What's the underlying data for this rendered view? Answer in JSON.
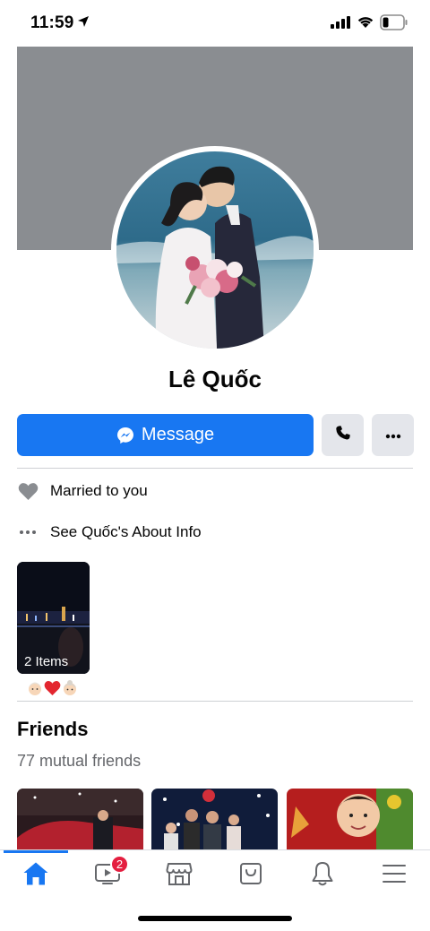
{
  "status_bar": {
    "time": "11:59"
  },
  "profile": {
    "name": "Lê Quốc",
    "message_label": "Message"
  },
  "info": {
    "relationship": "Married to you",
    "about": "See Quốc's About Info"
  },
  "highlight": {
    "label": "2 Items"
  },
  "friends": {
    "title": "Friends",
    "count": "77 mutual friends"
  },
  "tab_bar": {
    "items": [
      "home",
      "watch",
      "marketplace",
      "shop",
      "notifications",
      "menu"
    ],
    "watch_badge": "2"
  },
  "colors": {
    "accent": "#1877f2",
    "cover": "#8a8d91",
    "button_gray": "#e4e6eb",
    "badge": "#e41e3f"
  }
}
